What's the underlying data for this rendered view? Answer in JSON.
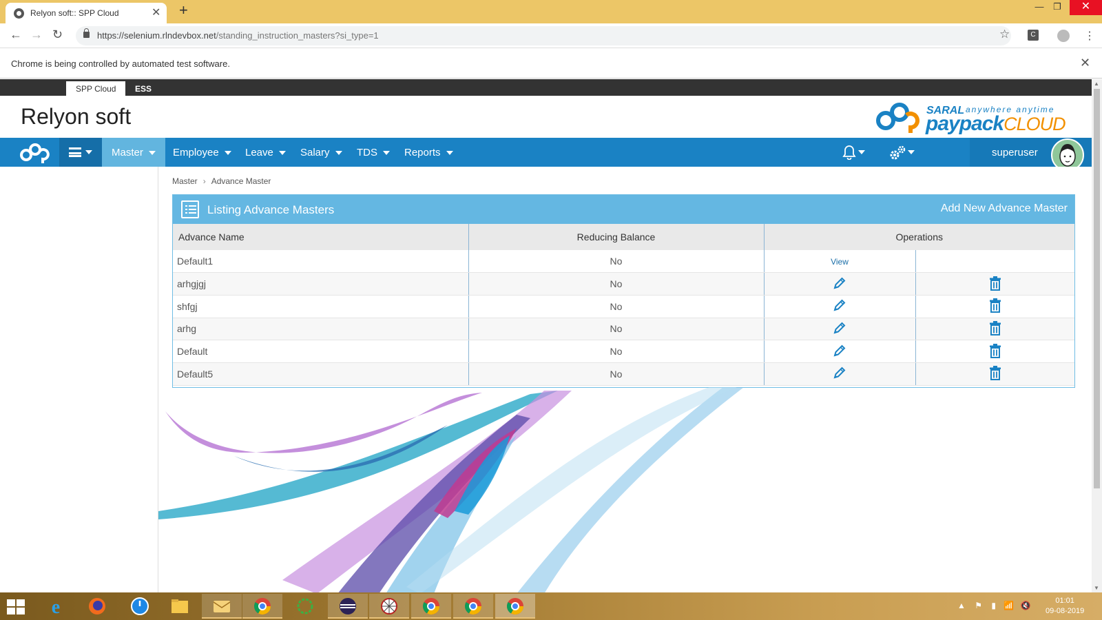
{
  "browser": {
    "tab_title": "Relyon soft:: SPP Cloud",
    "url_host": "https://selenium.rlndevbox.net",
    "url_path": "/standing_instruction_masters?si_type=1",
    "infobar_text": "Chrome is being controlled by automated test software."
  },
  "app_tabs": {
    "spp": "SPP Cloud",
    "ess": "ESS"
  },
  "brand": {
    "company": "Relyon soft",
    "logo_saral": "SARAL",
    "logo_tagline": "anywhere anytime",
    "logo_paypack": "paypack",
    "logo_cloud": "CLOUD"
  },
  "navbar": {
    "menus": [
      "Master",
      "Employee",
      "Leave",
      "Salary",
      "TDS",
      "Reports"
    ],
    "active_menu": "Master",
    "username": "superuser"
  },
  "breadcrumb": {
    "parent": "Master",
    "current": "Advance Master"
  },
  "panel": {
    "title": "Listing Advance Masters",
    "add_label": "Add New Advance Master"
  },
  "table": {
    "columns": [
      "Advance Name",
      "Reducing Balance",
      "Operations"
    ],
    "rows": [
      {
        "name": "Default1",
        "reducing_balance": "No",
        "operation": "View"
      },
      {
        "name": "arhgjgj",
        "reducing_balance": "No",
        "operation": "edit-delete"
      },
      {
        "name": "shfgj",
        "reducing_balance": "No",
        "operation": "edit-delete"
      },
      {
        "name": "arhg",
        "reducing_balance": "No",
        "operation": "edit-delete"
      },
      {
        "name": "Default",
        "reducing_balance": "No",
        "operation": "edit-delete"
      },
      {
        "name": "Default5",
        "reducing_balance": "No",
        "operation": "edit-delete"
      }
    ]
  },
  "taskbar": {
    "time": "01:01",
    "date": "09-08-2019"
  },
  "colors": {
    "navbar": "#1a82c4",
    "active_menu": "#62b5df",
    "panel_header": "#64b7e2",
    "logo_blue": "#1a82c4",
    "logo_orange": "#f29000"
  }
}
